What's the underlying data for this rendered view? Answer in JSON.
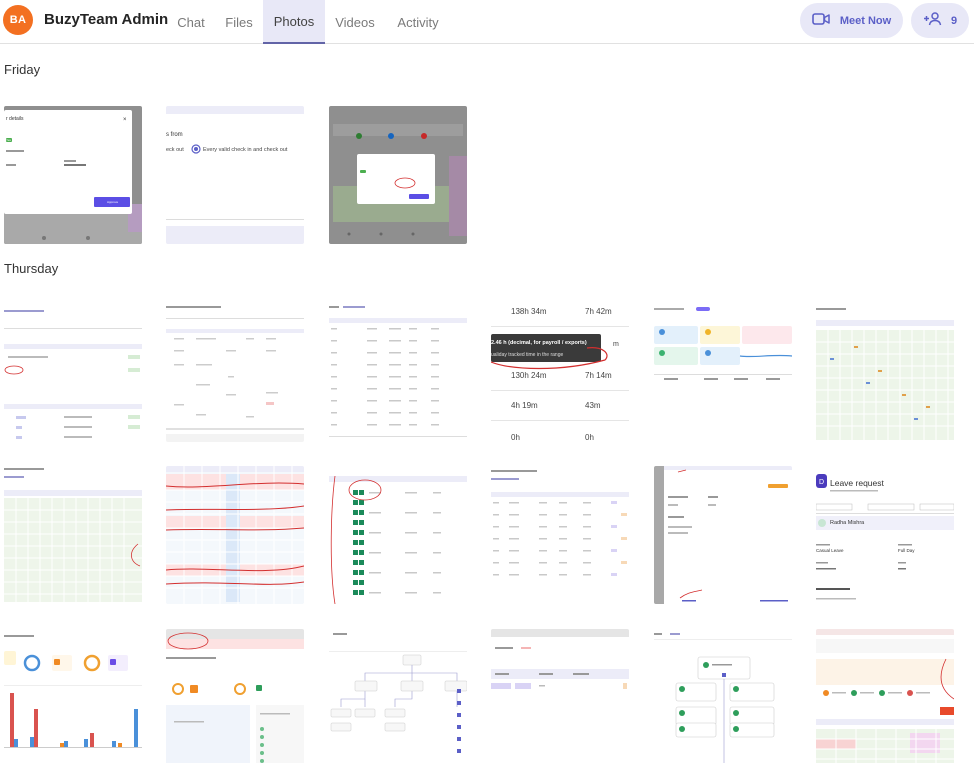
{
  "header": {
    "avatar_initials": "BA",
    "avatar_color": "#f37021",
    "team_name": "BuzyTeam Admin",
    "tabs": [
      {
        "label": "Chat",
        "active": false
      },
      {
        "label": "Files",
        "active": false
      },
      {
        "label": "Photos",
        "active": true
      },
      {
        "label": "Videos",
        "active": false
      },
      {
        "label": "Activity",
        "active": false
      }
    ],
    "meet_now_label": "Meet Now",
    "meet_icon": "video-camera-icon",
    "participants_icon": "people-add-icon",
    "participants_count": "9",
    "accent_color": "#5b5fc7"
  },
  "gallery": {
    "sections": [
      {
        "label": "Friday",
        "photos": [
          {
            "kind": "screenshot",
            "lines": [
              "r details",
              "Yes",
              "Approve"
            ]
          },
          {
            "kind": "screenshot",
            "lines": [
              "s from",
              "eck out",
              "Every valid check in and check out"
            ]
          },
          {
            "kind": "screenshot",
            "lines": []
          }
        ]
      },
      {
        "label": "Thursday",
        "photos": [
          {
            "kind": "screenshot",
            "lines": []
          },
          {
            "kind": "screenshot",
            "lines": []
          },
          {
            "kind": "screenshot",
            "lines": []
          },
          {
            "kind": "screenshot",
            "lines": [
              "138h 34m",
              "7h 42m",
              "2.46 h (decimal, for payroll / exports)",
              "ualiday tracked time in the range",
              "130h 24m",
              "7h 14m",
              "4h 19m",
              "43m",
              "0h",
              "0h"
            ]
          },
          {
            "kind": "screenshot",
            "lines": []
          },
          {
            "kind": "screenshot",
            "lines": []
          },
          {
            "kind": "screenshot",
            "lines": []
          },
          {
            "kind": "screenshot",
            "lines": []
          },
          {
            "kind": "screenshot",
            "lines": []
          },
          {
            "kind": "screenshot",
            "lines": []
          },
          {
            "kind": "screenshot",
            "lines": []
          },
          {
            "kind": "screenshot",
            "lines": [
              "Leave request",
              "Radha Mishra",
              "Casual Leave",
              "Full Day"
            ]
          },
          {
            "kind": "screenshot",
            "lines": []
          },
          {
            "kind": "screenshot",
            "lines": []
          },
          {
            "kind": "screenshot",
            "lines": []
          },
          {
            "kind": "screenshot",
            "lines": []
          },
          {
            "kind": "screenshot",
            "lines": []
          },
          {
            "kind": "screenshot",
            "lines": []
          }
        ]
      }
    ]
  }
}
